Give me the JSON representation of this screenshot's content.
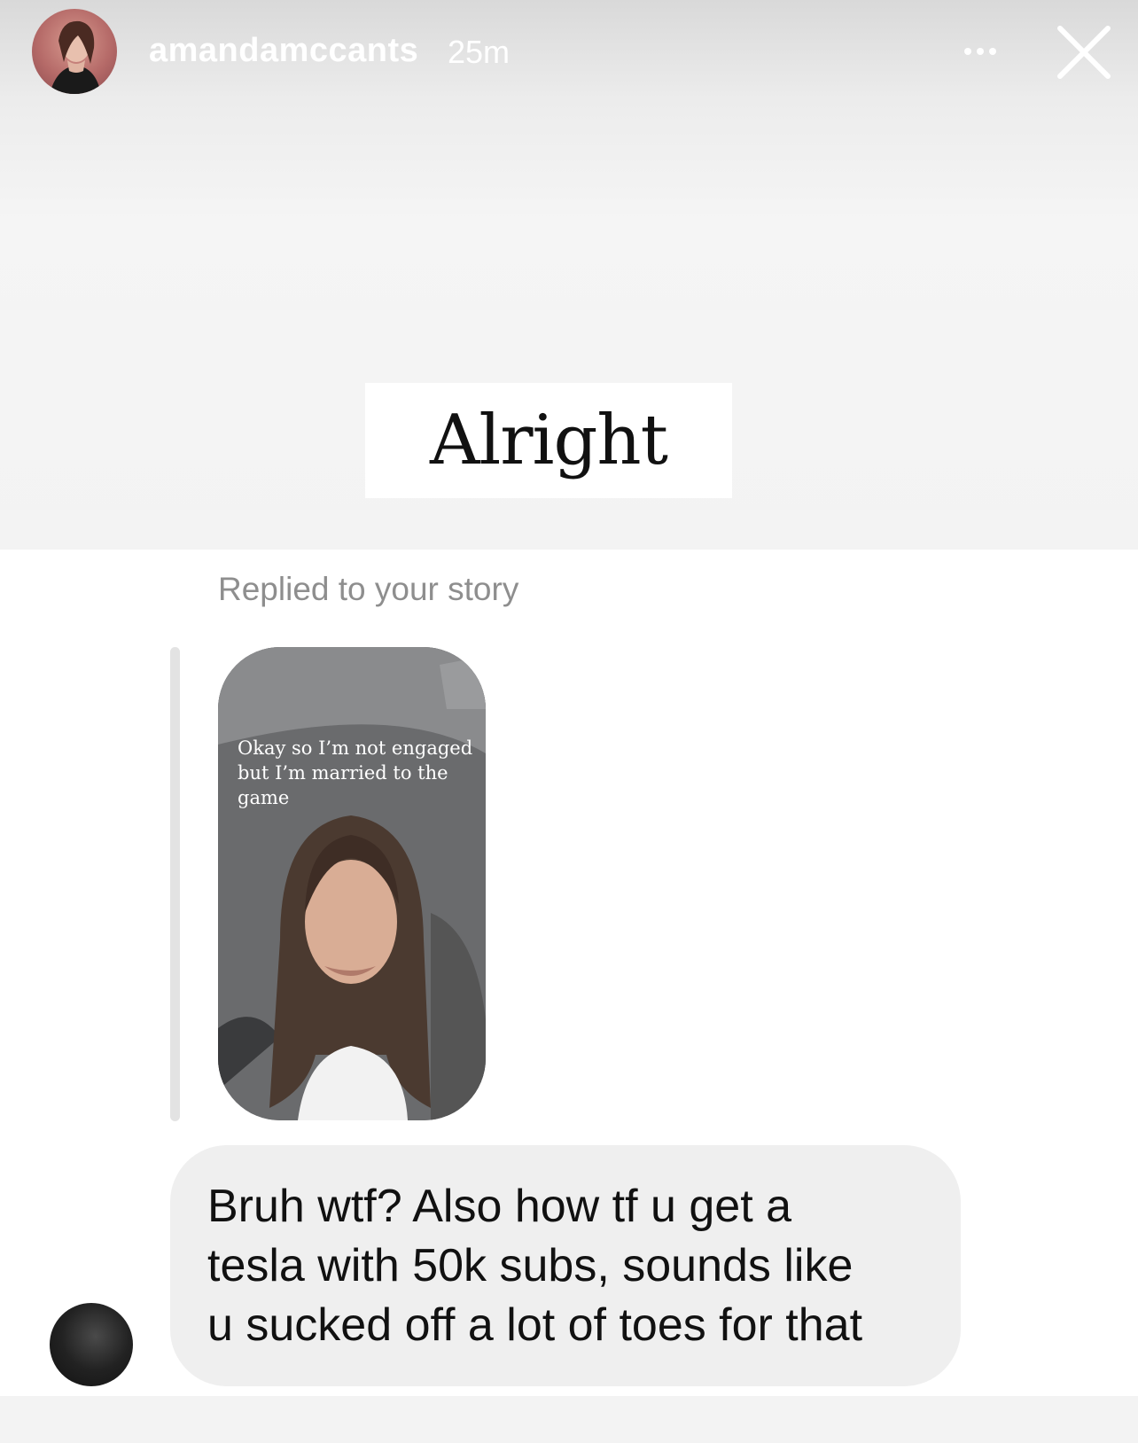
{
  "header": {
    "username": "amandamccants",
    "time": "25m",
    "avatar_icon": "profile-photo",
    "more_icon": "more-horizontal-icon",
    "close_icon": "close-icon"
  },
  "story": {
    "caption": "Alright"
  },
  "dm": {
    "replied_label": "Replied to your story",
    "story_thumbnail_text": "Okay so I’m not engaged\nbut I’m married to the\ngame",
    "message": "Bruh wtf? Also how tf u get a\ntesla with 50k subs, sounds like\nu sucked off a lot of toes for that"
  },
  "colors": {
    "caption_bg": "#ffffff",
    "bubble_bg": "#efefef",
    "muted_text": "#8e8e8e",
    "thread_line": "#e3e3e3"
  }
}
